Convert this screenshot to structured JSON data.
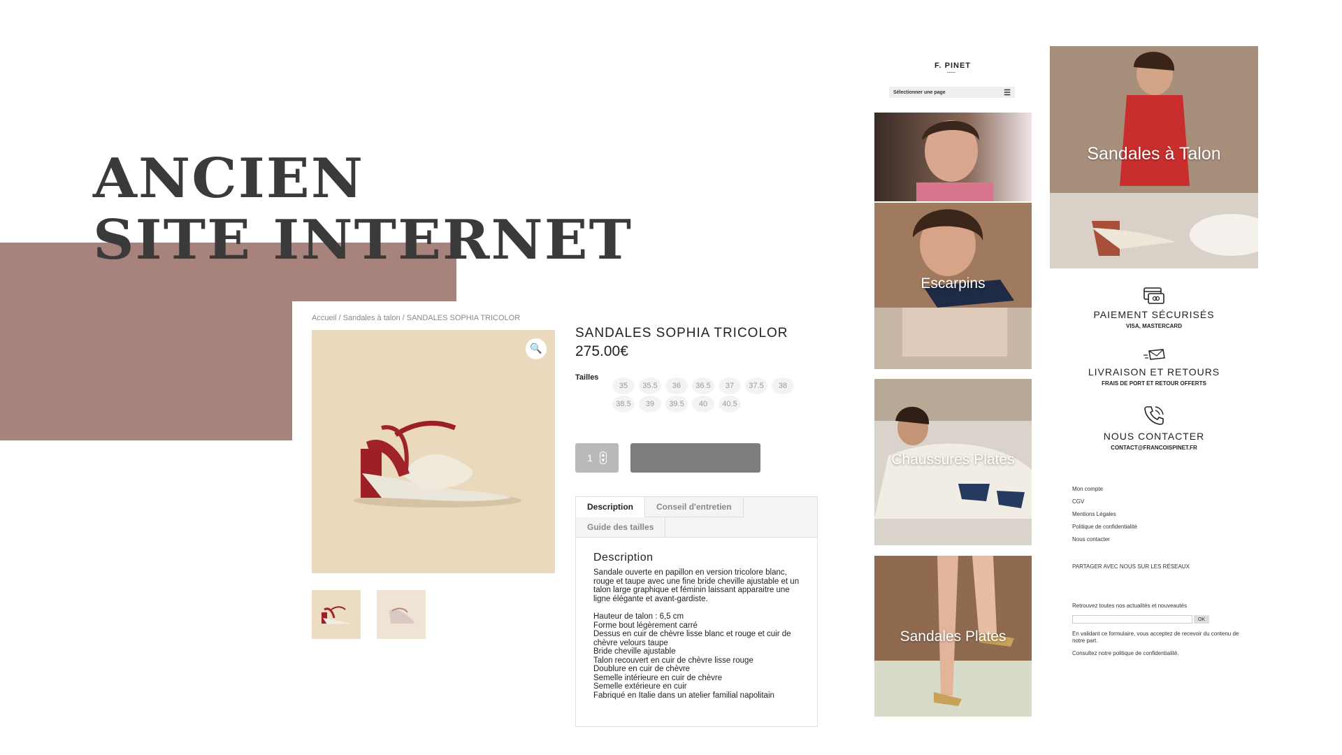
{
  "slide": {
    "title_line1": "ANCIEN",
    "title_line2": "SITE INTERNET"
  },
  "product_page": {
    "breadcrumb": "Accueil / Sandales à talon / SANDALES SOPHIA TRICOLOR",
    "title": "SANDALES SOPHIA TRICOLOR",
    "price": "275.00€",
    "sizes_label": "Tailles",
    "sizes": [
      "35",
      "35.5",
      "36",
      "36.5",
      "37",
      "37.5",
      "38",
      "38.5",
      "39",
      "39.5",
      "40",
      "40.5"
    ],
    "quantity": "1",
    "tabs": [
      "Description",
      "Conseil d'entretien",
      "Guide des tailles"
    ],
    "description_heading": "Description",
    "description_text": "Sandale ouverte en papillon en version tricolore blanc, rouge et taupe avec une fine bride cheville ajustable et un talon large graphique et féminin laissant apparaitre une ligne élégante et avant-gardiste.",
    "details": [
      "Hauteur de talon : 6,5 cm",
      "Forme bout légèrement carré",
      "Dessus en cuir de chèvre lisse blanc et rouge et cuir de chèvre velours taupe",
      "Bride cheville ajustable",
      "Talon recouvert en cuir de chèvre lisse rouge",
      "Doublure en cuir de chèvre",
      "Semelle intérieure en cuir de chèvre",
      "Semelle extérieure en cuir",
      "Fabriqué en Italie dans un atelier familial napolitain"
    ]
  },
  "mobile_home": {
    "logo": "F. PINET",
    "select_label": "Sélectionner une page",
    "categories": [
      "Escarpins",
      "Chaussures Plates",
      "Sandales Plates"
    ]
  },
  "mobile_footer": {
    "hero_label": "Sandales à Talon",
    "features": [
      {
        "title": "PAIEMENT SÉCURISÉS",
        "sub": "VISA, MASTERCARD",
        "icon": "card-icon"
      },
      {
        "title": "LIVRAISON ET RETOURS",
        "sub": "FRAIS DE PORT ET RETOUR OFFERTS",
        "icon": "envelope-icon"
      },
      {
        "title": "NOUS CONTACTER",
        "sub": "CONTACT@FRANCOISPINET.FR",
        "icon": "phone-icon"
      }
    ],
    "links": [
      "Mon compte",
      "CGV",
      "Mentions Légales",
      "Politique de confidentialité",
      "Nous contacter"
    ],
    "share": "PARTAGER AVEC NOUS SUR LES RÉSEAUX",
    "newsletter_text": "Retrouvez toutes nos actualités et nouveautés",
    "newsletter_ok": "OK",
    "consent": "En validant ce formulaire, vous acceptez de recevoir du contenu de notre part.",
    "policy": "Consultez notre politique de confidentialité."
  },
  "colors": {
    "mauve": "#a8837d",
    "title": "#3a3a3a",
    "button_gray": "#7d7d7d"
  }
}
